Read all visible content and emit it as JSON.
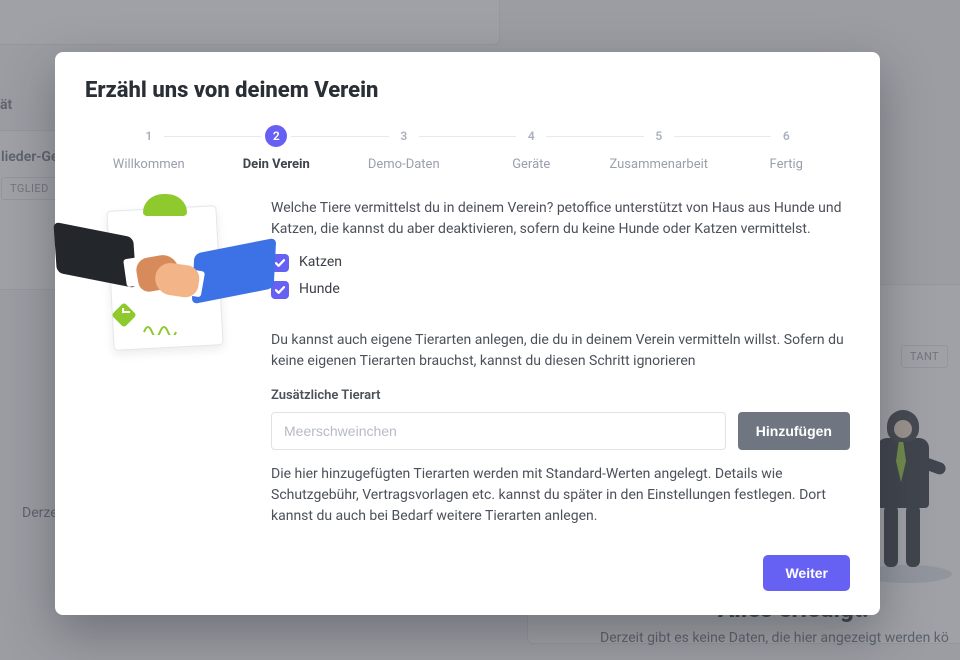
{
  "modal": {
    "title": "Erzähl uns von deinem Verein",
    "steps": [
      {
        "num": "1",
        "label": "Willkommen"
      },
      {
        "num": "2",
        "label": "Dein Verein"
      },
      {
        "num": "3",
        "label": "Demo-Daten"
      },
      {
        "num": "4",
        "label": "Geräte"
      },
      {
        "num": "5",
        "label": "Zusammenarbeit"
      },
      {
        "num": "6",
        "label": "Fertig"
      }
    ],
    "current_step_index": 1,
    "intro": "Welche Tiere vermittelst du in deinem Verein? petoffice unterstützt von Haus aus Hunde und Katzen, die kannst du aber deaktivieren, sofern du keine Hunde oder Katzen vermittelst.",
    "checkboxes": {
      "cats": {
        "label": "Katzen",
        "checked": true
      },
      "dogs": {
        "label": "Hunde",
        "checked": true
      }
    },
    "custom_intro": "Du kannst auch eigene Tierarten anlegen, die du in deinem Verein vermitteln willst. Sofern du keine eigenen Tierarten brauchst, kannst du diesen Schritt ignorieren",
    "field_label": "Zusätzliche Tierart",
    "field_placeholder": "Meerschweinchen",
    "field_value": "",
    "add_button": "Hinzufügen",
    "hint": "Die hier hinzugefügten Tierarten werden mit Standard-Werten angelegt. Details wie Schutzgebühr, Vertragsvorlagen etc. kannst du später in den Einstellungen festlegen. Dort kannst du auch bei Bedarf weitere Tierarten anlegen.",
    "next_button": "Weiter"
  },
  "background": {
    "trunc_at": "ät",
    "trunc_glied": "lieder-Ge",
    "badge_tglied": "TGLIED",
    "derzeit": "Derzeit",
    "tant_badge": "TANT",
    "done_heading": "Alles erledigt!",
    "done_sub": "Derzeit gibt es keine Daten, die hier angezeigt werden kö"
  },
  "colors": {
    "accent": "#6761f3",
    "accent_green": "#8ec92d"
  }
}
